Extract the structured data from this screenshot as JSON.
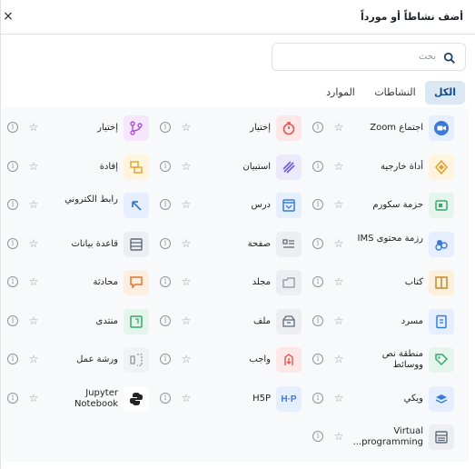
{
  "dialog": {
    "title": "أضف نشاطاً أو مورداً",
    "close": "×"
  },
  "search": {
    "placeholder": "بحث"
  },
  "tabs": [
    {
      "label": "الكل",
      "active": true
    },
    {
      "label": "النشاطات",
      "active": false
    },
    {
      "label": "الموارد",
      "active": false
    }
  ],
  "items": [
    {
      "label": "اجتماع Zoom",
      "icon": "video-camera-icon",
      "color": "#3a7bd5"
    },
    {
      "label": "إختيار",
      "icon": "clock-icon",
      "color": "#e55353"
    },
    {
      "label": "إختيار",
      "icon": "branch-icon",
      "color": "#b04dd6"
    },
    {
      "label": "أداة خارجية",
      "icon": "puzzle-icon",
      "color": "#e0a030"
    },
    {
      "label": "استبيان",
      "icon": "survey-icon",
      "color": "#6f5bd6"
    },
    {
      "label": "إفادة",
      "icon": "feedback-icon",
      "color": "#e0a030"
    },
    {
      "label": "حزمة سكورم",
      "icon": "scorm-icon",
      "color": "#3aa76d"
    },
    {
      "label": "درس",
      "icon": "lesson-icon",
      "color": "#3a7bd5"
    },
    {
      "label": "رابط الكتروني",
      "icon": "arrow-link-icon",
      "color": "#3a7bd5"
    },
    {
      "label": "رزمة محتوى IMS",
      "icon": "ims-icon",
      "color": "#3a7bd5"
    },
    {
      "label": "صفحة",
      "icon": "page-icon",
      "color": "#5f6b7a"
    },
    {
      "label": "قاعدة بيانات",
      "icon": "database-icon",
      "color": "#5f6b7a"
    },
    {
      "label": "كتاب",
      "icon": "book-icon",
      "color": "#c58a2c"
    },
    {
      "label": "مجلد",
      "icon": "folder-icon",
      "color": "#5f6b7a"
    },
    {
      "label": "محادثة",
      "icon": "chat-icon",
      "color": "#e0762c"
    },
    {
      "label": "مسرد",
      "icon": "glossary-icon",
      "color": "#3a7bd5"
    },
    {
      "label": "ملف",
      "icon": "file-icon",
      "color": "#5f6b7a"
    },
    {
      "label": "منتدى",
      "icon": "forum-icon",
      "color": "#3aa76d"
    },
    {
      "label": "منطقة نص ووسائط",
      "icon": "tag-icon",
      "color": "#3aa76d"
    },
    {
      "label": "واجب",
      "icon": "assignment-icon",
      "color": "#e55353"
    },
    {
      "label": "ورشة عمل",
      "icon": "workshop-icon",
      "color": "#8f959e"
    },
    {
      "label": "ويكي",
      "icon": "wiki-icon",
      "color": "#3a7bd5"
    },
    {
      "label": "H5P",
      "icon": "h5p-icon",
      "color": "#3a7bd5"
    },
    {
      "label": "Jupyter Notebook",
      "icon": "python-icon",
      "color": "#222222"
    },
    {
      "label": "Virtual programming...",
      "icon": "vpl-icon",
      "color": "#5f6b7a"
    }
  ],
  "actions": {
    "star": "☆",
    "info": "i"
  }
}
